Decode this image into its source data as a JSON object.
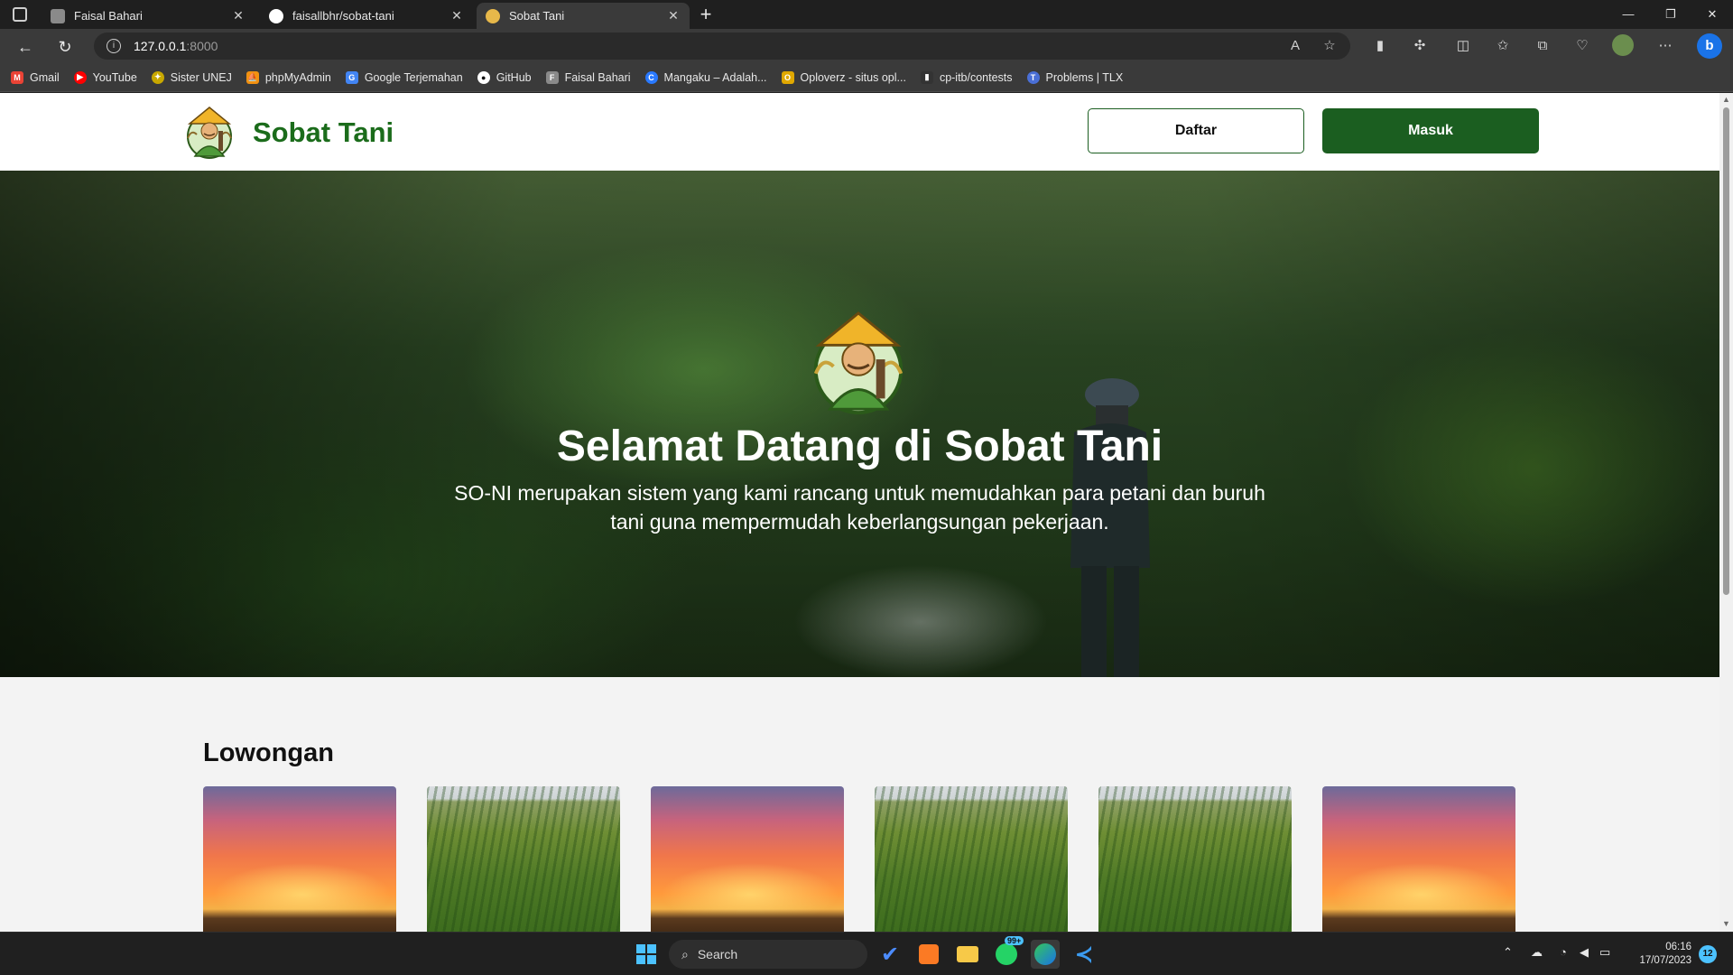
{
  "browser": {
    "tabs": [
      {
        "title": "Faisal Bahari",
        "icon": "profile-icon",
        "active": false
      },
      {
        "title": "faisallbhr/sobat-tani",
        "icon": "github-icon",
        "active": false
      },
      {
        "title": "Sobat Tani",
        "icon": "farmer-icon",
        "active": true
      }
    ],
    "new_tab": "+",
    "url_host": "127.0.0.1",
    "url_port": ":8000",
    "bookmarks": [
      {
        "label": "Gmail",
        "icon": "gmail-icon",
        "color": "#ea4335",
        "glyph": "M"
      },
      {
        "label": "YouTube",
        "icon": "youtube-icon",
        "color": "#ff0000",
        "glyph": "▶"
      },
      {
        "label": "Sister UNEJ",
        "icon": "unej-icon",
        "color": "#f4c20d",
        "glyph": "✦"
      },
      {
        "label": "phpMyAdmin",
        "icon": "phpmyadmin-icon",
        "color": "#f29111",
        "glyph": "⛵"
      },
      {
        "label": "Google Terjemahan",
        "icon": "translate-icon",
        "color": "#4285f4",
        "glyph": "G"
      },
      {
        "label": "GitHub",
        "icon": "github-icon",
        "color": "#ffffff",
        "glyph": "●"
      },
      {
        "label": "Faisal Bahari",
        "icon": "profile-icon",
        "color": "#8a8a8a",
        "glyph": "F"
      },
      {
        "label": "Mangaku – Adalah...",
        "icon": "mangaku-icon",
        "color": "#2979ff",
        "glyph": "C"
      },
      {
        "label": "Oploverz - situs opl...",
        "icon": "oploverz-icon",
        "color": "#e0a800",
        "glyph": "O"
      },
      {
        "label": "cp-itb/contests",
        "icon": "cp-itb-icon",
        "color": "#333333",
        "glyph": "▮"
      },
      {
        "label": "Problems | TLX",
        "icon": "tlx-icon",
        "color": "#4a6fd6",
        "glyph": "T"
      }
    ]
  },
  "site": {
    "brand_name": "Sobat Tani",
    "btn_register": "Daftar",
    "btn_login": "Masuk",
    "hero_title": "Selamat Datang di Sobat Tani",
    "hero_desc": "SO-NI merupakan sistem yang kami rancang untuk memudahkan para petani dan buruh tani guna mempermudah keberlangsungan pekerjaan.",
    "section_title": "Lowongan",
    "cards": [
      {
        "image": "sunset"
      },
      {
        "image": "field"
      },
      {
        "image": "sunset"
      },
      {
        "image": "field"
      },
      {
        "image": "field"
      },
      {
        "image": "sunset"
      }
    ]
  },
  "taskbar": {
    "search_label": "Search",
    "whatsapp_badge": "99+",
    "time": "06:16",
    "date": "17/07/2023",
    "notifications": "12"
  },
  "colors": {
    "brand_green": "#1b6c1b",
    "button_green": "#1b5e20"
  }
}
